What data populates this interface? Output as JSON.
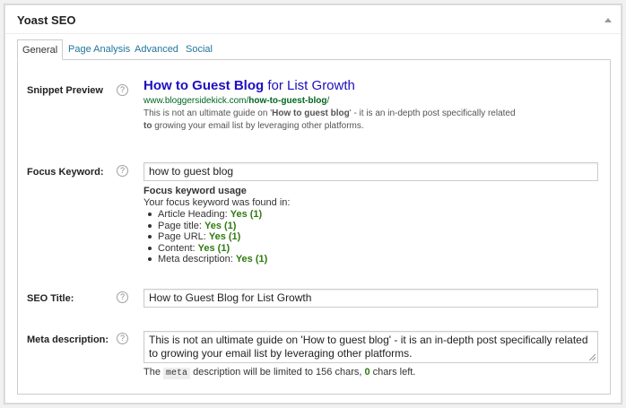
{
  "metabox": {
    "title": "Yoast SEO"
  },
  "tabs": [
    {
      "label": "General",
      "active": true
    },
    {
      "label": "Page Analysis",
      "active": false
    },
    {
      "label": "Advanced",
      "active": false
    },
    {
      "label": "Social",
      "active": false
    }
  ],
  "snippet": {
    "label": "Snippet Preview",
    "title_bold": "How to Guest Blog",
    "title_rest": " for List Growth",
    "url_prefix": "www.bloggersidekick.com/",
    "url_bold": "how-to-guest-blog",
    "url_suffix": "/",
    "desc_1": "This is not an ultimate guide on '",
    "desc_bold_1": "How to guest blog",
    "desc_2": "' - it is an in-depth post specifically related ",
    "desc_bold_2": "to",
    "desc_3": " growing your email list by leveraging other platforms."
  },
  "focus": {
    "label": "Focus Keyword:",
    "value": "how to guest blog",
    "usage_heading": "Focus keyword usage",
    "found_text": "Your focus keyword was found in:",
    "items": [
      {
        "label": "Article Heading:",
        "result": "Yes (1)"
      },
      {
        "label": "Page title:",
        "result": "Yes (1)"
      },
      {
        "label": "Page URL:",
        "result": "Yes (1)"
      },
      {
        "label": "Content:",
        "result": "Yes (1)"
      },
      {
        "label": "Meta description:",
        "result": "Yes (1)"
      }
    ]
  },
  "seo_title": {
    "label": "SEO Title:",
    "value": "How to Guest Blog for List Growth"
  },
  "meta": {
    "label": "Meta description:",
    "value": "This is not an ultimate guide on 'How to guest blog' - it is an in-depth post specifically related to growing your email list by leveraging other platforms.",
    "limit_pre": "The",
    "limit_code": "meta",
    "limit_mid": "description will be limited to 156 chars,",
    "limit_count": "0",
    "limit_post": "chars left."
  },
  "help_icon": "?",
  "colors": {
    "link": "#21759b",
    "snippet_title": "#1e0fbe",
    "snippet_url": "#006621",
    "good": "#2f7a10"
  }
}
